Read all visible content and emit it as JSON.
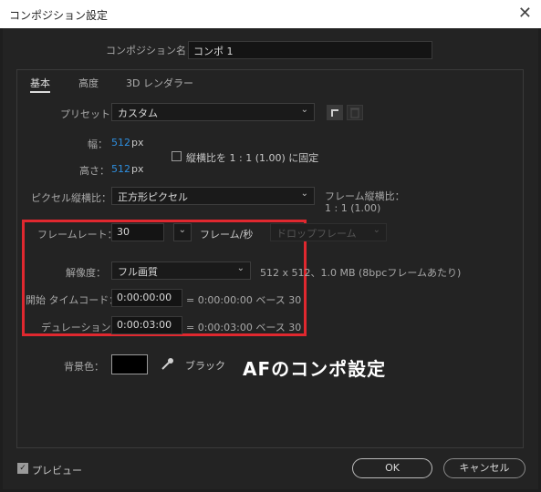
{
  "window": {
    "title": "コンポジション設定"
  },
  "comp_name": {
    "label": "コンポジション名：",
    "value": "コンポ 1"
  },
  "tabs": [
    {
      "label": "基本"
    },
    {
      "label": "高度"
    },
    {
      "label": "3D レンダラー"
    }
  ],
  "preset": {
    "label": "プリセット：",
    "value": "カスタム"
  },
  "width": {
    "label": "幅：",
    "value": "512",
    "unit": "px"
  },
  "height": {
    "label": "高さ：",
    "value": "512",
    "unit": "px"
  },
  "aspect_lock": {
    "label": "縦横比を 1 : 1 (1.00) に固定",
    "checked": false
  },
  "pixel_aspect": {
    "label": "ピクセル縦横比：",
    "value": "正方形ピクセル"
  },
  "frame_aspect": {
    "label": "フレーム縦横比：",
    "value": "1 : 1 (1.00)"
  },
  "frame_rate": {
    "label": "フレームレート：",
    "value": "30",
    "unit": "フレーム/秒",
    "drop_frame": "ドロップフレーム"
  },
  "resolution": {
    "label": "解像度：",
    "value": "フル画質",
    "info": "512 x 512、1.0 MB (8bpcフレームあたり)"
  },
  "start_timecode": {
    "label": "開始 タイムコード：",
    "value": "0:00:00:00",
    "info": "= 0:00:00:00  ベース 30"
  },
  "duration": {
    "label": "デュレーション：",
    "value": "0:00:03:00",
    "info": "= 0:00:03:00  ベース 30"
  },
  "background": {
    "label": "背景色：",
    "color": "#000000",
    "name": "ブラック"
  },
  "annotation": {
    "text": "AFのコンポ設定",
    "color": "#ffffff"
  },
  "preview": {
    "label": "プレビュー",
    "checked": true
  },
  "buttons": {
    "ok": "OK",
    "cancel": "キャンセル"
  },
  "colors": {
    "accent_blue": "#2e8fe0",
    "highlight_red": "#e0282f"
  }
}
